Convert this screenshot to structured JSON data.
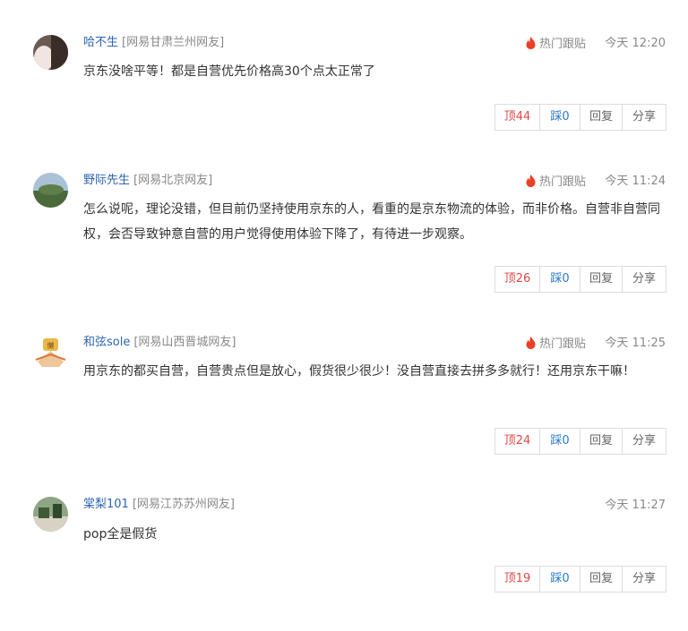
{
  "labels": {
    "hot_follow": "热门跟贴",
    "reply": "回复",
    "share": "分享"
  },
  "colors": {
    "username": "#2d64b3",
    "up": "#e04848",
    "down": "#2d7bc9",
    "hot_icon": "#e8402a"
  },
  "comments": [
    {
      "user": "哈不生",
      "location": "[网易甘肃兰州网友]",
      "hot": true,
      "time": "今天 12:20",
      "text": "京东没啥平等！都是自营优先价格高30个点太正常了",
      "up": "顶44",
      "down": "踩0"
    },
    {
      "user": "野际先生",
      "location": "[网易北京网友]",
      "hot": true,
      "time": "今天 11:24",
      "text": "怎么说呢，理论没错，但目前仍坚持使用京东的人，看重的是京东物流的体验，而非价格。自营非自营同权，会否导致钟意自营的用户觉得使用体验下降了，有待进一步观察。",
      "up": "顶26",
      "down": "踩0"
    },
    {
      "user": "和弦sole",
      "location": "[网易山西晋城网友]",
      "hot": true,
      "time": "今天 11:25",
      "text": "用京东的都买自营，自营贵点但是放心，假货很少很少！没自营直接去拼多多就行！还用京东干嘛！",
      "up": "顶24",
      "down": "踩0"
    },
    {
      "user": "棠梨101",
      "location": "[网易江苏苏州网友]",
      "hot": false,
      "time": "今天 11:27",
      "text": "pop全是假货",
      "up": "顶19",
      "down": "踩0"
    }
  ]
}
